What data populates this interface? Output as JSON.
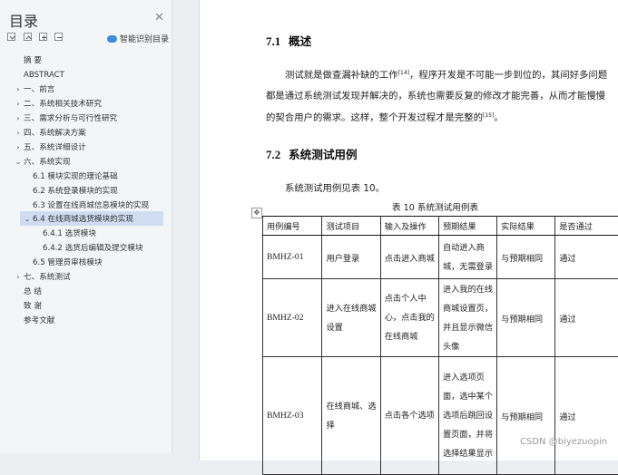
{
  "nav": {
    "title": "目录",
    "smart_toc_label": "智能识别目录",
    "items": [
      {
        "label": "摘  要",
        "arrow": ""
      },
      {
        "label": "ABSTRACT",
        "arrow": ""
      },
      {
        "label": "一、前言",
        "arrow": "›"
      },
      {
        "label": "二、系统相关技术研究",
        "arrow": "›"
      },
      {
        "label": "三、需求分析与可行性研究",
        "arrow": "›"
      },
      {
        "label": "四、系统解决方案",
        "arrow": "›"
      },
      {
        "label": "五、系统详细设计",
        "arrow": "›"
      },
      {
        "label": "六、系统实现",
        "arrow": "⌄"
      },
      {
        "label": "6.1 模块实现的理论基础",
        "arrow": ""
      },
      {
        "label": "6.2 系统登录模块的实现",
        "arrow": ""
      },
      {
        "label": "6.3 设置在线商城信息模块的实现",
        "arrow": ""
      },
      {
        "label": "6.4 在线商城选货模块的实现",
        "arrow": "⌄"
      },
      {
        "label": "6.4.1 选货模块",
        "arrow": ""
      },
      {
        "label": "6.4.2 选货后编辑及提交模块",
        "arrow": ""
      },
      {
        "label": "6.5 管理员审核模块",
        "arrow": ""
      },
      {
        "label": "七、系统测试",
        "arrow": "›"
      },
      {
        "label": "总  结",
        "arrow": ""
      },
      {
        "label": "致  谢",
        "arrow": ""
      },
      {
        "label": "参考文献",
        "arrow": ""
      }
    ]
  },
  "doc": {
    "h71_num": "7.1",
    "h71_text": "概述",
    "p1_a": "测试就是做查漏补缺的工作",
    "p1_ref1": "[14]",
    "p1_b": "，程序开发是不可能一步到位的，其间好多问题都是通过系统测试发现并解决的，系统也需要反复的修改才能完善，从而才能慢慢的契合用户的需求。这样，整个开发过程才是完整的",
    "p1_ref2": "[15]",
    "p1_c": "。",
    "h72_num": "7.2",
    "h72_text": "系统测试用例",
    "p2": "系统测试用例见表 10。",
    "table_caption": "表 10  系统测试用例表",
    "table_headers": [
      "用例编号",
      "测试项目",
      "输入及操作",
      "预期结果",
      "实际结果",
      "是否通过"
    ],
    "table_rows": [
      [
        "BMHZ-01",
        "用户登录",
        "点击进入商城",
        "自动进入商城，无需登录",
        "与预期相同",
        "通过"
      ],
      [
        "BMHZ-02",
        "进入在线商城设置",
        "点击个人中心，点击我的在线商城",
        "进入我的在线商城设置页，并且显示微信头像",
        "与预期相同",
        "通过"
      ],
      [
        "BMHZ-03",
        "在线商城、选择",
        "点击各个选项",
        "进入选项页面，选中某个选项后跳回设置页面，并将选择结果显示",
        "与预期相同",
        "通过"
      ]
    ]
  },
  "watermark": "CSDN @biyezuopin"
}
